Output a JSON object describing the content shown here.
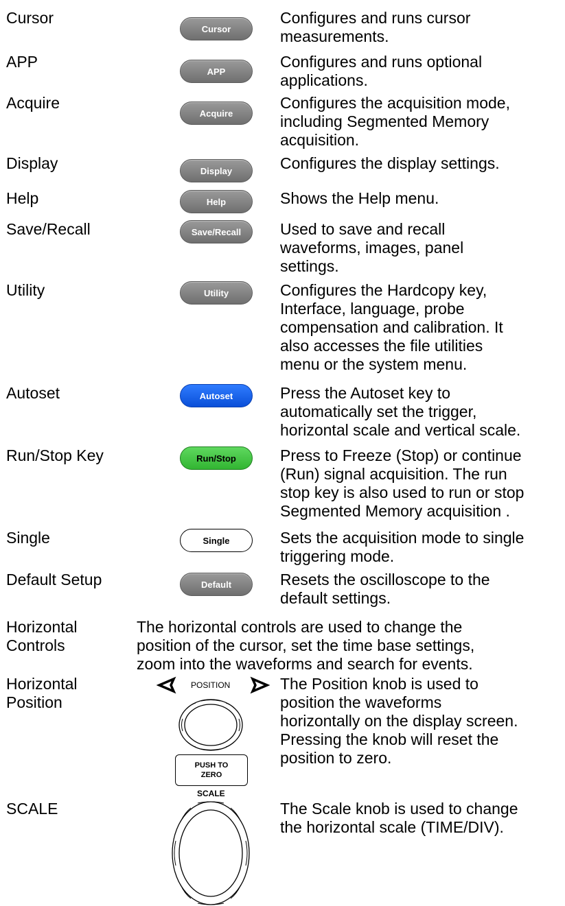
{
  "rows": [
    {
      "term": "Cursor",
      "key_label": "Cursor",
      "key_style": "gray",
      "desc": [
        "Configures and runs cursor",
        "measurements."
      ]
    },
    {
      "term": "APP",
      "key_label": "APP",
      "key_style": "gray",
      "desc": [
        "Configures and runs optional",
        "applications."
      ]
    },
    {
      "term": "Acquire",
      "key_label": "Acquire",
      "key_style": "gray",
      "desc": [
        "Configures the acquisition mode,",
        "including Segmented Memory",
        "acquisition."
      ]
    },
    {
      "term": "Display",
      "key_label": "Display",
      "key_style": "gray",
      "desc": [
        "Configures the display settings."
      ]
    },
    {
      "term": "Help",
      "key_label": "Help",
      "key_style": "gray",
      "desc": [
        "Shows the Help menu."
      ]
    },
    {
      "term": "Save/Recall",
      "key_label": "Save/Recall",
      "key_style": "gray",
      "desc": [
        "Used to save and recall",
        "waveforms, images, panel",
        "settings."
      ]
    },
    {
      "term": "Utility",
      "key_label": "Utility",
      "key_style": "gray",
      "desc": [
        "Configures the Hardcopy key,",
        "Interface, language, probe",
        "compensation and calibration.  It",
        "also accesses the file utilities",
        "menu or the system menu."
      ]
    },
    {
      "term": "Autoset",
      "key_label": "Autoset",
      "key_style": "blue",
      "desc": [
        "Press the Autoset key to",
        "automatically set the trigger,",
        "horizontal scale and vertical scale."
      ]
    },
    {
      "term": "Run/Stop Key",
      "key_label": "Run/Stop",
      "key_style": "green",
      "desc": [
        "Press to Freeze (Stop) or continue",
        "(Run) signal acquisition. The run",
        "stop key is also used to run or stop",
        "Segmented Memory acquisition ."
      ]
    },
    {
      "term": "Single",
      "key_label": "Single",
      "key_style": "white",
      "desc": [
        "Sets the acquisition mode to single",
        "triggering mode."
      ]
    },
    {
      "term": "Default Setup",
      "key_label": "Default",
      "key_style": "gray",
      "desc": [
        "Resets the oscilloscope to the",
        "default settings."
      ]
    }
  ],
  "horizontal_controls": {
    "term": [
      "Horizontal",
      "Controls"
    ],
    "desc": [
      "The horizontal controls are used to change the",
      "position of the cursor, set the time base settings,",
      "zoom into the waveforms and search for events."
    ]
  },
  "horizontal_position": {
    "term": [
      "Horizontal",
      "Position"
    ],
    "knob_label": "POSITION",
    "push_label": [
      "PUSH TO",
      "ZERO"
    ],
    "desc": [
      "The Position knob is used to",
      "position the waveforms",
      "horizontally on the display screen.",
      "Pressing the knob will reset the",
      "position to zero."
    ]
  },
  "scale": {
    "term": "SCALE",
    "knob_label": "SCALE",
    "desc": [
      "The Scale knob is used to change",
      "the horizontal scale (TIME/DIV)."
    ]
  },
  "colors": {
    "gray_key": "#7f7f7f",
    "blue_key": "#1a66f0",
    "green_key": "#46c646"
  }
}
